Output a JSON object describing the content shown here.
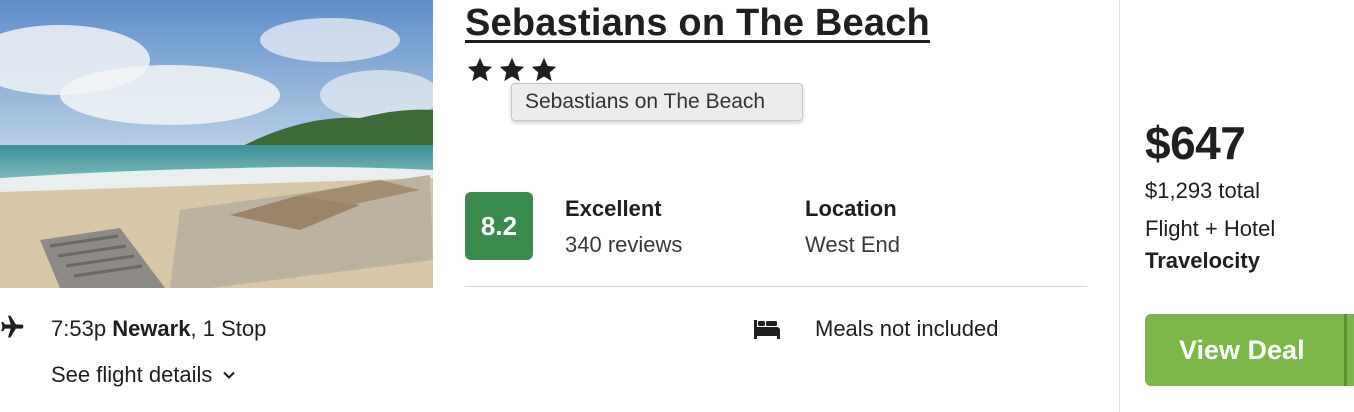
{
  "hotel": {
    "name": "Sebastians on The Beach",
    "star_count": 3,
    "tooltip": "Sebastians on The Beach",
    "image_icon": "beach-photo"
  },
  "rating": {
    "score": "8.2",
    "label": "Excellent",
    "reviews": "340 reviews",
    "badge_color": "#3a8a4e"
  },
  "location": {
    "label": "Location",
    "value": "West End"
  },
  "flight": {
    "icon": "plane-icon",
    "time": "7:53p",
    "airport": "Newark",
    "stops": ", 1 Stop",
    "details_link": "See flight details"
  },
  "meals": {
    "icon": "bed-icon",
    "text": "Meals not included"
  },
  "deal": {
    "price": "$647",
    "total": "$1,293 total",
    "package": "Flight + Hotel",
    "provider": "Travelocity",
    "button_label": "View Deal",
    "button_color": "#7ab648"
  }
}
